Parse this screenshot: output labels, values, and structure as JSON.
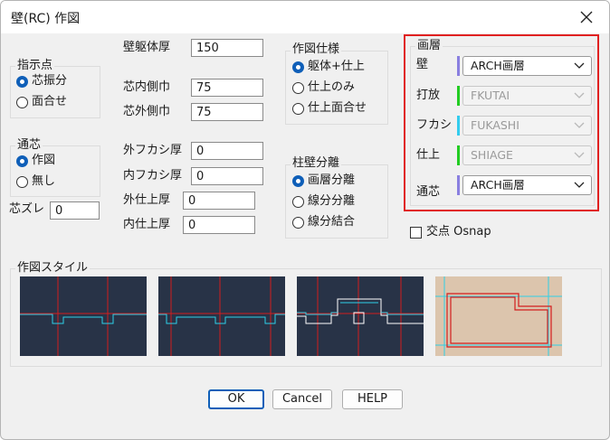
{
  "window": {
    "title": "壁(RC) 作図"
  },
  "wall_thickness": {
    "label": "壁躯体厚",
    "value": "150"
  },
  "core_inner": {
    "label": "芯内側巾",
    "value": "75"
  },
  "core_outer": {
    "label": "芯外側巾",
    "value": "75"
  },
  "point_group": {
    "title": "指示点",
    "options": [
      {
        "label": "芯振分",
        "selected": true
      },
      {
        "label": "面合せ",
        "selected": false
      }
    ]
  },
  "core_group": {
    "title": "通芯",
    "options": [
      {
        "label": "作図",
        "selected": true
      },
      {
        "label": "無し",
        "selected": false
      }
    ]
  },
  "core_offset": {
    "label": "芯ズレ",
    "value": "0"
  },
  "finishing": {
    "outer_fukashi": {
      "label": "外フカシ厚",
      "value": "0"
    },
    "inner_fukashi": {
      "label": "内フカシ厚",
      "value": "0"
    },
    "outer_finish": {
      "label": "外仕上厚",
      "value": "0"
    },
    "inner_finish": {
      "label": "内仕上厚",
      "value": "0"
    }
  },
  "spec_group": {
    "title": "作図仕様",
    "options": [
      {
        "label": "躯体+仕上",
        "selected": true
      },
      {
        "label": "仕上のみ",
        "selected": false
      },
      {
        "label": "仕上面合せ",
        "selected": false
      }
    ]
  },
  "sep_group": {
    "title": "柱壁分離",
    "options": [
      {
        "label": "画層分離",
        "selected": true
      },
      {
        "label": "線分分離",
        "selected": false
      },
      {
        "label": "線分結合",
        "selected": false
      }
    ]
  },
  "layers": {
    "title": "画層",
    "rows": [
      {
        "label": "壁",
        "value": "ARCH画層",
        "enabled": true,
        "color": "#8a7fe0"
      },
      {
        "label": "打放",
        "value": "FKUTAI",
        "enabled": false,
        "color": "#22cc22"
      },
      {
        "label": "フカシ",
        "value": "FUKASHI",
        "enabled": false,
        "color": "#33ccee"
      },
      {
        "label": "仕上",
        "value": "SHIAGE",
        "enabled": false,
        "color": "#22cc22"
      },
      {
        "label": "通芯",
        "value": "ARCH画層",
        "enabled": true,
        "color": "#8a7fe0"
      }
    ],
    "highlight_color": "#e02020"
  },
  "osnap": {
    "label": "交点 Osnap",
    "checked": false
  },
  "style_group": {
    "title": "作図スタイル"
  },
  "buttons": {
    "ok": "OK",
    "cancel": "Cancel",
    "help": "HELP"
  },
  "colors": {
    "accent": "#0f5fb8",
    "preview_bg": "#283347",
    "preview_bg_4": "#dcc5ad",
    "wall_red": "#d21e1e",
    "core_cyan": "#2ed0e8"
  }
}
